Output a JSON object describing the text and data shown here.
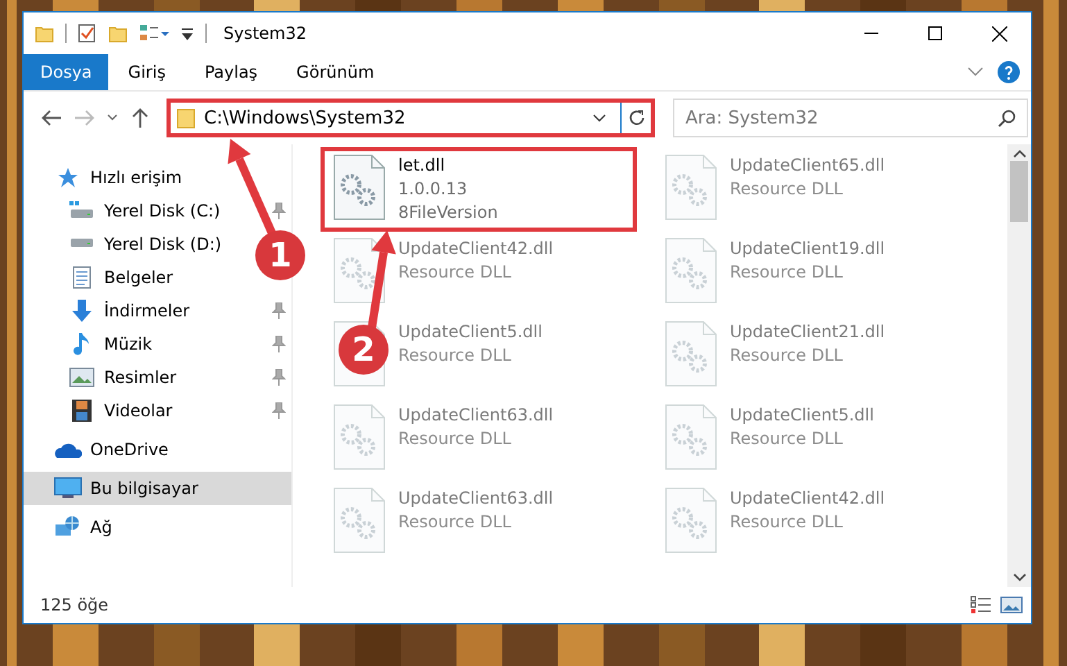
{
  "window": {
    "title": "System32"
  },
  "ribbon_tabs": [
    {
      "label": "Dosya",
      "selected": true
    },
    {
      "label": "Giriş",
      "selected": false
    },
    {
      "label": "Paylaş",
      "selected": false
    },
    {
      "label": "Görünüm",
      "selected": false
    }
  ],
  "address_bar": {
    "value": "C:\\Windows\\System32",
    "highlighted": true
  },
  "search": {
    "placeholder": "Ara: System32"
  },
  "navigation": [
    {
      "label": "Hızlı erişim",
      "kind": "section",
      "pinned": false,
      "selected": false
    },
    {
      "label": "Yerel Disk (C:)",
      "kind": "item",
      "pinned": true,
      "selected": false
    },
    {
      "label": "Yerel Disk (D:)",
      "kind": "item",
      "pinned": false,
      "selected": false
    },
    {
      "label": "Belgeler",
      "kind": "item",
      "pinned": false,
      "selected": false
    },
    {
      "label": "İndirmeler",
      "kind": "item",
      "pinned": true,
      "selected": false
    },
    {
      "label": "Müzik",
      "kind": "item",
      "pinned": true,
      "selected": false
    },
    {
      "label": "Resimler",
      "kind": "item",
      "pinned": true,
      "selected": false
    },
    {
      "label": "Videolar",
      "kind": "item",
      "pinned": true,
      "selected": false
    },
    {
      "label": "OneDrive",
      "kind": "section",
      "pinned": false,
      "selected": false
    },
    {
      "label": "Bu bilgisayar",
      "kind": "section",
      "pinned": false,
      "selected": true
    },
    {
      "label": "Ağ",
      "kind": "section",
      "pinned": false,
      "selected": false
    }
  ],
  "files": [
    {
      "name": "let.dll",
      "details": [
        "1.0.0.13",
        "8FileVersion"
      ],
      "highlighted": true,
      "blurred": false
    },
    {
      "name": "UpdateClient65.dll",
      "details": [
        "Resource DLL"
      ],
      "highlighted": false,
      "blurred": true
    },
    {
      "name": "UpdateClient42.dll",
      "details": [
        "Resource DLL"
      ],
      "highlighted": false,
      "blurred": true
    },
    {
      "name": "UpdateClient19.dll",
      "details": [
        "Resource DLL"
      ],
      "highlighted": false,
      "blurred": true
    },
    {
      "name": "UpdateClient5.dll",
      "details": [
        "Resource DLL"
      ],
      "highlighted": false,
      "blurred": true
    },
    {
      "name": "UpdateClient21.dll",
      "details": [
        "Resource DLL"
      ],
      "highlighted": false,
      "blurred": true
    },
    {
      "name": "UpdateClient63.dll",
      "details": [
        "Resource DLL"
      ],
      "highlighted": false,
      "blurred": true
    },
    {
      "name": "UpdateClient5.dll",
      "details": [
        "Resource DLL"
      ],
      "highlighted": false,
      "blurred": true
    },
    {
      "name": "UpdateClient63.dll",
      "details": [
        "Resource DLL"
      ],
      "highlighted": false,
      "blurred": true
    },
    {
      "name": "UpdateClient42.dll",
      "details": [
        "Resource DLL"
      ],
      "highlighted": false,
      "blurred": true
    }
  ],
  "status_bar": {
    "item_count": "125 öğe"
  },
  "annotations": [
    {
      "label": "1"
    },
    {
      "label": "2"
    }
  ]
}
